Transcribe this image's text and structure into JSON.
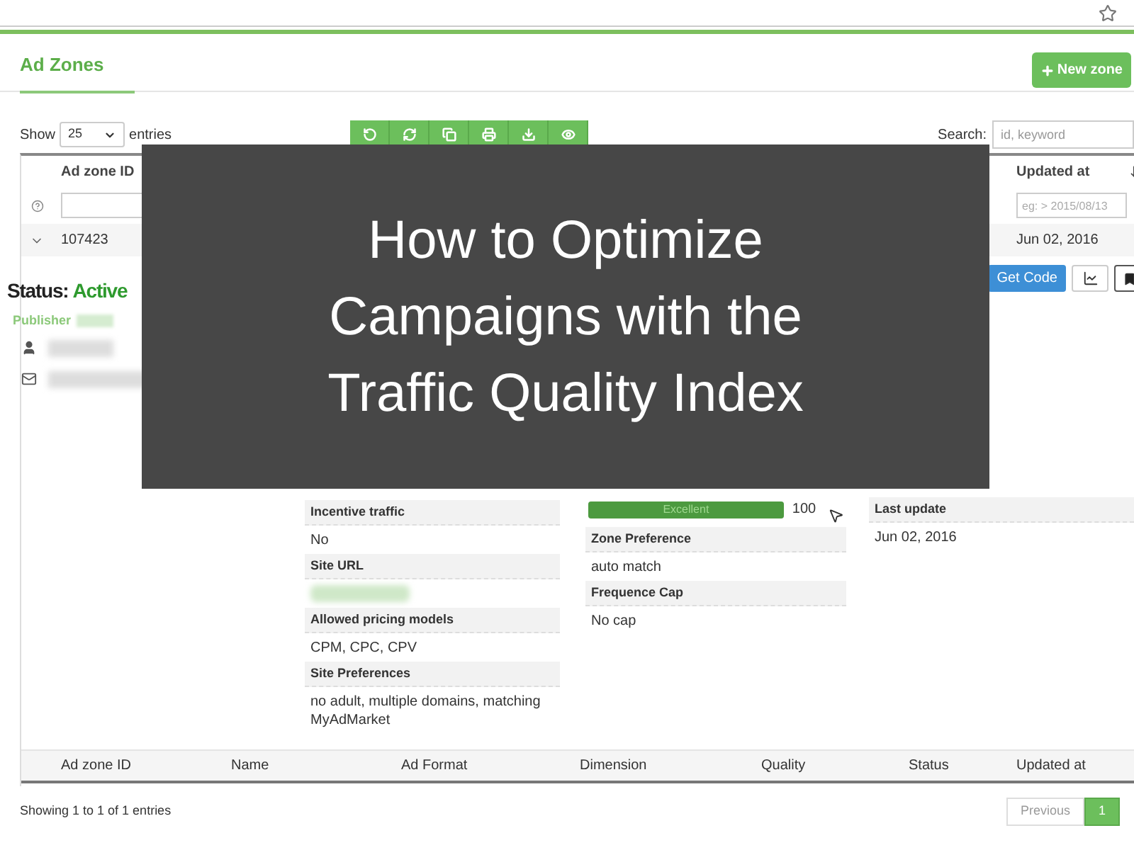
{
  "page_title": "Ad Zones",
  "new_button": "New zone",
  "length_menu": {
    "label_before": "Show",
    "value": "25",
    "label_after": "entries"
  },
  "search": {
    "label": "Search:",
    "placeholder": "id, keyword"
  },
  "overlay_title": "How to Optimize Campaigns with the Traffic Quality Index",
  "table": {
    "first_column": "Ad zone ID",
    "last_column": "Updated at",
    "updated_filter_placeholder": "eg: > 2015/08/13",
    "row": {
      "expanded": true,
      "ad_zone_id": "107423",
      "updated_at": "Jun 02, 2016"
    },
    "footer_columns": [
      "Ad zone ID",
      "Name",
      "Ad Format",
      "Dimension",
      "Quality",
      "Status",
      "Updated at"
    ]
  },
  "detail": {
    "status_label": "Status:",
    "status_value": "Active",
    "publisher_label": "Publisher",
    "get_code": "Get Code",
    "fields_left": [
      {
        "label": "Incentive traffic",
        "kind": "text",
        "value": "No"
      },
      {
        "label": "Site URL",
        "kind": "blurred"
      },
      {
        "label": "Allowed pricing models",
        "kind": "text",
        "value": "CPM, CPC, CPV"
      },
      {
        "label": "Site Preferences",
        "kind": "text",
        "value": "no adult, multiple domains, matching MyAdMarket"
      }
    ],
    "quality": {
      "label": "Excellent",
      "level": 1,
      "reading": "100"
    },
    "fields_mid": [
      {
        "label": "Zone Preference",
        "kind": "text",
        "value": "auto match"
      },
      {
        "label": "Frequence Cap",
        "kind": "text",
        "value": "No cap"
      }
    ],
    "fields_right": [
      {
        "label": "Last update",
        "kind": "text",
        "value": "Jun 02, 2016"
      }
    ]
  },
  "pagination": {
    "info": "Showing 1 to 1 of 1 entries",
    "pages": [
      {
        "label": "Previous",
        "selected": false
      },
      {
        "label": "1",
        "selected": true
      }
    ]
  }
}
